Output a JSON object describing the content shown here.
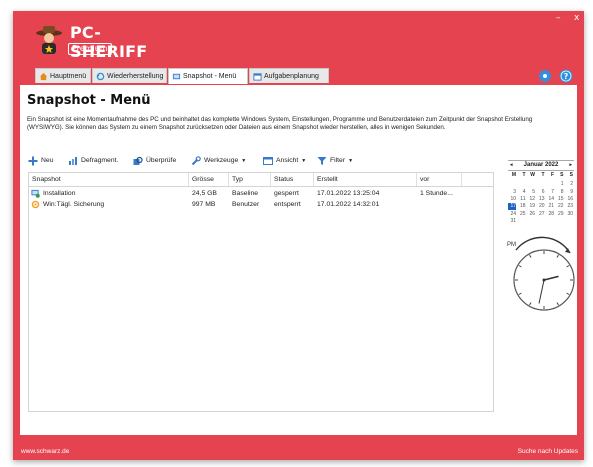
{
  "window": {
    "min_glyph": "–",
    "close_glyph": "x"
  },
  "brand": {
    "name": "PC-SHERIFF",
    "edition": "Premium"
  },
  "tabs": [
    {
      "label": "Hauptmenü",
      "active": false
    },
    {
      "label": "Wiederherstellung",
      "active": false
    },
    {
      "label": "Snapshot - Menü",
      "active": true
    },
    {
      "label": "Aufgabenplanung",
      "active": false
    }
  ],
  "page": {
    "title": "Snapshot  -  Menü",
    "description": "Ein Snapshot ist eine Momentaufnahme des PC und beinhaltet das komplette Windows System, Einstellungen, Programme und Benutzerdateien zum Zeitpunkt der Snapshot Erstellung (WYSIWYG). Sie können das System zu einem Snapshot zurücksetzen oder Dateien aus einem Snapshot wieder herstellen, alles in wenigen Sekunden."
  },
  "toolbar": {
    "new": "Neu",
    "defrag": "Defragment.",
    "check": "Überprüfe",
    "tools": "Werkzeuge",
    "view": "Ansicht",
    "filter": "Filter"
  },
  "table": {
    "columns": [
      "Snapshot",
      "Grösse",
      "Typ",
      "Status",
      "Erstellt",
      "vor"
    ],
    "rows": [
      {
        "name": "Installation",
        "size": "24,5 GB",
        "type": "Baseline",
        "status": "gesperrt",
        "created": "17.01.2022 13:25:04",
        "ago": "1 Stunde...",
        "icon": "baseline-snapshot-icon"
      },
      {
        "name": "Win:Tägl. Sicherung",
        "size": "997 MB",
        "type": "Benutzer",
        "status": "entsperrt",
        "created": "17.01.2022 14:32:01",
        "ago": "",
        "icon": "user-snapshot-icon"
      }
    ]
  },
  "calendar": {
    "title": "Januar 2022",
    "prev": "◂",
    "next": "▸",
    "weekdays": [
      "M",
      "T",
      "W",
      "T",
      "F",
      "S",
      "S"
    ],
    "selected_day": "17",
    "weeks": [
      [
        "",
        "",
        "",
        "",
        "",
        "1",
        "2"
      ],
      [
        "3",
        "4",
        "5",
        "6",
        "7",
        "8",
        "9"
      ],
      [
        "10",
        "11",
        "12",
        "13",
        "14",
        "15",
        "16"
      ],
      [
        "17",
        "18",
        "19",
        "20",
        "21",
        "22",
        "23"
      ],
      [
        "24",
        "25",
        "26",
        "27",
        "28",
        "29",
        "30"
      ],
      [
        "31",
        "",
        "",
        "",
        "",
        "",
        ""
      ]
    ]
  },
  "clock": {
    "period": "PM",
    "time": "14:32"
  },
  "footer": {
    "website": "www.schwarz.de",
    "update": "Suche nach Updates"
  },
  "colors": {
    "brand_red": "#e54350",
    "accent_blue": "#1e62c0"
  }
}
